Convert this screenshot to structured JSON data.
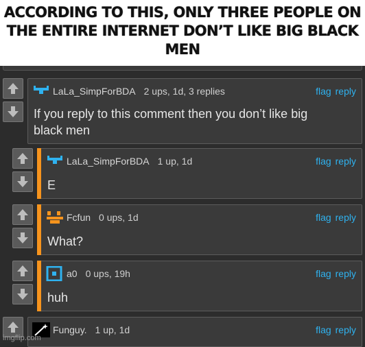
{
  "caption": {
    "line1": "ACCORDING TO THIS, ONLY THREE PEOPLE ON",
    "line2": "THE ENTIRE INTERNET DON’T LIKE BIG BLACK MEN"
  },
  "colors": {
    "accent": "#f7941d",
    "link": "#2fb2ef",
    "background": "#2c2c2c",
    "panel": "#3a3a3a"
  },
  "comments": [
    {
      "user": "LaLa_SimpForBDA",
      "meta": "2 ups, 1d, 3 replies",
      "flag": "flag",
      "reply": "reply",
      "text_line1": "If you reply to this comment then you don’t like big",
      "text_line2": "black men",
      "avatar": "blue-visor-icon"
    },
    {
      "user": "LaLa_SimpForBDA",
      "meta": "1 up, 1d",
      "flag": "flag",
      "reply": "reply",
      "text": "E",
      "avatar": "blue-visor-icon"
    },
    {
      "user": "Fcfun",
      "meta": "0 ups, 1d",
      "flag": "flag",
      "reply": "reply",
      "text": "What?",
      "avatar": "orange-face-icon"
    },
    {
      "user": "a0",
      "meta": "0 ups, 19h",
      "flag": "flag",
      "reply": "reply",
      "text": "huh",
      "avatar": "blue-square-icon"
    },
    {
      "user": "Funguy.",
      "meta": "1 up, 1d",
      "flag": "flag",
      "reply": "reply",
      "avatar": "star-wand-icon"
    }
  ],
  "watermark": "imgflip.com"
}
